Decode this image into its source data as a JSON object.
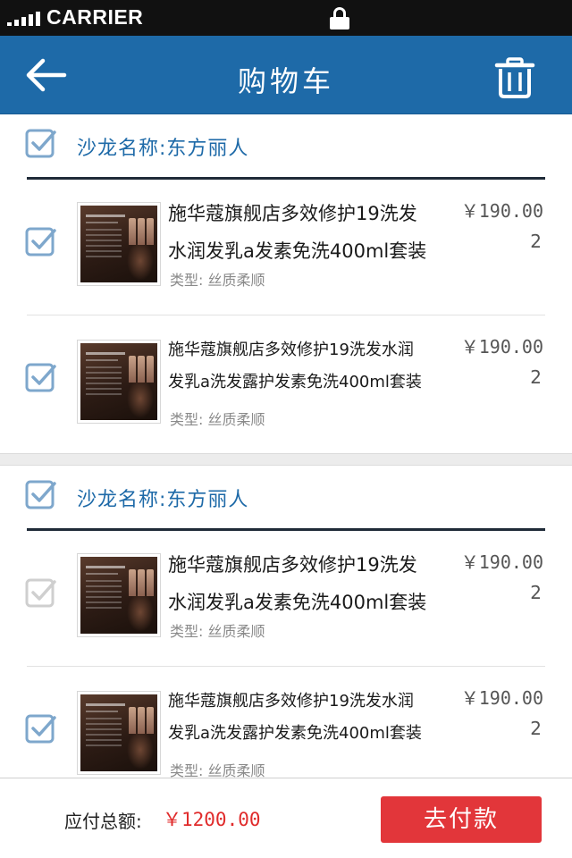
{
  "status_bar": {
    "carrier": "CARRIER"
  },
  "nav": {
    "title": "购物车",
    "back_icon": "arrow-left-icon",
    "delete_icon": "trash-icon"
  },
  "colors": {
    "nav_bg": "#1e6aa8",
    "shop_name": "#1e6aa8",
    "check_on": "#7ea7cc",
    "check_off": "#cfcfcf",
    "pay_button": "#e2363a",
    "total_amount": "#e02b2b"
  },
  "shops": [
    {
      "name": "沙龙名称:东方丽人",
      "checked": true,
      "items": [
        {
          "title_line1": "施华蔻旗舰店多效修护19洗发",
          "title_line2": "水润发乳a发素免洗400ml套装",
          "type": "类型: 丝质柔顺",
          "price": "￥190.00",
          "qty": "2",
          "checked": true
        },
        {
          "title_line1": "施华蔻旗舰店多效修护19洗发水润",
          "title_line2": "发乳a洗发露护发素免洗400ml套装",
          "type": "类型: 丝质柔顺",
          "price": "￥190.00",
          "qty": "2",
          "checked": true
        }
      ]
    },
    {
      "name": "沙龙名称:东方丽人",
      "checked": true,
      "items": [
        {
          "title_line1": "施华蔻旗舰店多效修护19洗发",
          "title_line2": "水润发乳a发素免洗400ml套装",
          "type": "类型: 丝质柔顺",
          "price": "￥190.00",
          "qty": "2",
          "checked": false
        },
        {
          "title_line1": "施华蔻旗舰店多效修护19洗发水润",
          "title_line2": "发乳a洗发露护发素免洗400ml套装",
          "type": "类型: 丝质柔顺",
          "price": "￥190.00",
          "qty": "2",
          "checked": true
        }
      ]
    }
  ],
  "footer": {
    "total_label": "应付总额:",
    "total_amount": "￥1200.00",
    "pay_label": "去付款"
  }
}
